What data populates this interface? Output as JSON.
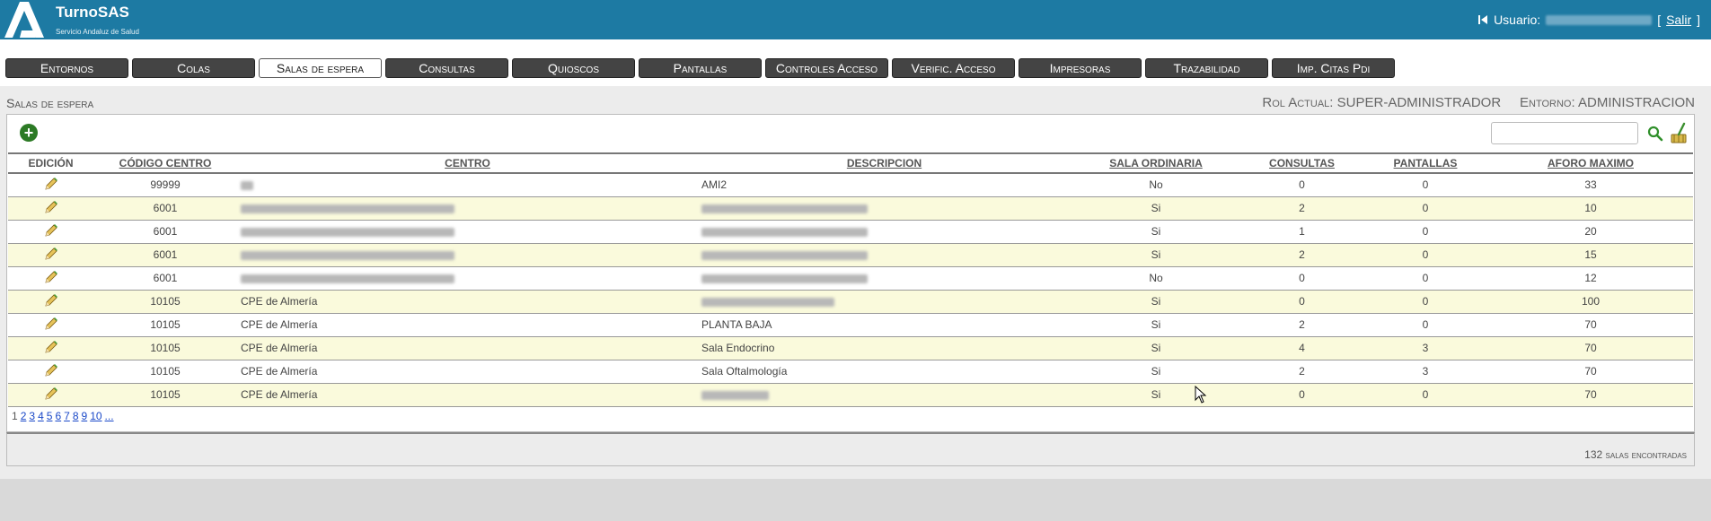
{
  "header": {
    "brand": "TurnoSAS",
    "subtitle": "Servicio Andaluz de Salud",
    "user_label": "Usuario:",
    "logout_prefix": "[",
    "logout_label": "Salir",
    "logout_suffix": "]"
  },
  "tabs": [
    {
      "label": "Entornos",
      "active": false
    },
    {
      "label": "Colas",
      "active": false
    },
    {
      "label": "Salas de espera",
      "active": true
    },
    {
      "label": "Consultas",
      "active": false
    },
    {
      "label": "Quioscos",
      "active": false
    },
    {
      "label": "Pantallas",
      "active": false
    },
    {
      "label": "Controles Acceso",
      "active": false
    },
    {
      "label": "Verific. Acceso",
      "active": false
    },
    {
      "label": "Impresoras",
      "active": false
    },
    {
      "label": "Trazabilidad",
      "active": false
    },
    {
      "label": "Imp. Citas Pdi",
      "active": false
    }
  ],
  "page": {
    "title": "Salas de espera",
    "role_label": "Rol Actual:",
    "role_value": "SUPER-ADMINISTRADOR",
    "env_label": "Entorno:",
    "env_value": "ADMINISTRACION"
  },
  "table": {
    "headers": [
      "EDICIÓN",
      "CÓDIGO CENTRO",
      "CENTRO",
      "DESCRIPCION",
      "SALA ORDINARIA",
      "CONSULTAS",
      "PANTALLAS",
      "AFORO MAXIMO"
    ],
    "rows": [
      {
        "codigo": "99999",
        "centro": "",
        "descripcion": "AMI2",
        "ordinaria": "No",
        "consultas": "0",
        "pantallas": "0",
        "aforo": "33"
      },
      {
        "codigo": "6001",
        "centro": "",
        "descripcion": "",
        "ordinaria": "Si",
        "consultas": "2",
        "pantallas": "0",
        "aforo": "10"
      },
      {
        "codigo": "6001",
        "centro": "",
        "descripcion": "",
        "ordinaria": "Si",
        "consultas": "1",
        "pantallas": "0",
        "aforo": "20"
      },
      {
        "codigo": "6001",
        "centro": "",
        "descripcion": "",
        "ordinaria": "Si",
        "consultas": "2",
        "pantallas": "0",
        "aforo": "15"
      },
      {
        "codigo": "6001",
        "centro": "",
        "descripcion": "",
        "ordinaria": "No",
        "consultas": "0",
        "pantallas": "0",
        "aforo": "12"
      },
      {
        "codigo": "10105",
        "centro": "CPE de Almería",
        "descripcion": "",
        "ordinaria": "Si",
        "consultas": "0",
        "pantallas": "0",
        "aforo": "100"
      },
      {
        "codigo": "10105",
        "centro": "CPE de Almería",
        "descripcion": "PLANTA BAJA",
        "ordinaria": "Si",
        "consultas": "2",
        "pantallas": "0",
        "aforo": "70"
      },
      {
        "codigo": "10105",
        "centro": "CPE de Almería",
        "descripcion": "Sala Endocrino",
        "ordinaria": "Si",
        "consultas": "4",
        "pantallas": "3",
        "aforo": "70"
      },
      {
        "codigo": "10105",
        "centro": "CPE de Almería",
        "descripcion": "Sala Oftalmología",
        "ordinaria": "Si",
        "consultas": "2",
        "pantallas": "3",
        "aforo": "70"
      },
      {
        "codigo": "10105",
        "centro": "CPE de Almería",
        "descripcion": "",
        "ordinaria": "Si",
        "consultas": "0",
        "pantallas": "0",
        "aforo": "70"
      }
    ]
  },
  "pager": {
    "current": "1",
    "pages": [
      "2",
      "3",
      "4",
      "5",
      "6",
      "7",
      "8",
      "9",
      "10",
      "..."
    ]
  },
  "footer": {
    "count_text": "132 salas encontradas"
  },
  "icons": {
    "edit": "pencil-icon",
    "add": "add-icon",
    "search": "search-icon",
    "clear": "clear-filter-icon"
  }
}
